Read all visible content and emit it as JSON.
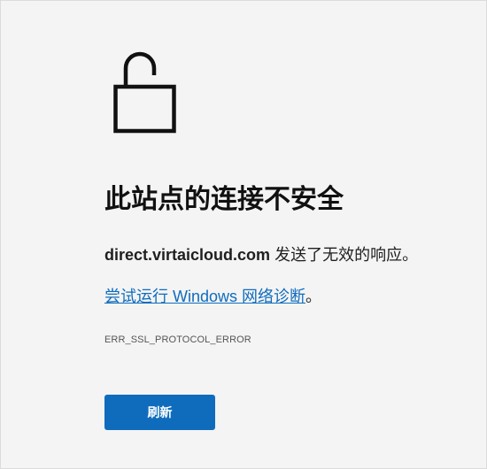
{
  "error_page": {
    "title": "此站点的连接不安全",
    "description": {
      "host": "direct.virtaicloud.com",
      "message": " 发送了无效的响应。"
    },
    "diagnostic": {
      "link_text": "尝试运行 Windows 网络诊断",
      "suffix": "。"
    },
    "error_code": "ERR_SSL_PROTOCOL_ERROR",
    "refresh_label": "刷新",
    "icon": "unlocked-padlock-icon"
  },
  "colors": {
    "background": "#f4f4f4",
    "accent": "#0f6cbd",
    "text": "#1f1f1f"
  }
}
